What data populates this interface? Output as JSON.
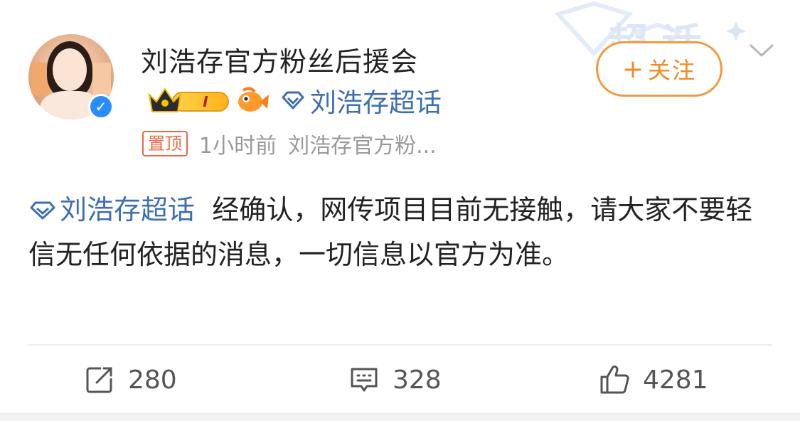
{
  "post": {
    "username": "刘浩存官方粉丝后援会",
    "level_badge": "I",
    "supertopic_badge": "刘浩存超话",
    "pin_label": "置顶",
    "time": "1小时前",
    "source": "刘浩存官方粉...",
    "follow_label": "关注",
    "follow_plus": "+",
    "content_topic": "刘浩存超话",
    "content_text": "经确认，网传项目目前无接触，请大家不要轻信无任何依据的消息，一切信息以官方为准。"
  },
  "actions": {
    "repost_count": "280",
    "comment_count": "328",
    "like_count": "4281"
  },
  "colors": {
    "link_blue": "#3e6fb0",
    "follow_orange": "#f08a20",
    "pin_red": "#e86a46",
    "verified_blue": "#2b8cff"
  },
  "icons": {
    "verified": "verified-check-icon",
    "crown": "crown-icon",
    "fish": "fish-icon",
    "diamond": "diamond-icon",
    "chevron": "chevron-down-icon",
    "repost": "repost-icon",
    "comment": "comment-icon",
    "like": "thumbs-up-icon"
  }
}
